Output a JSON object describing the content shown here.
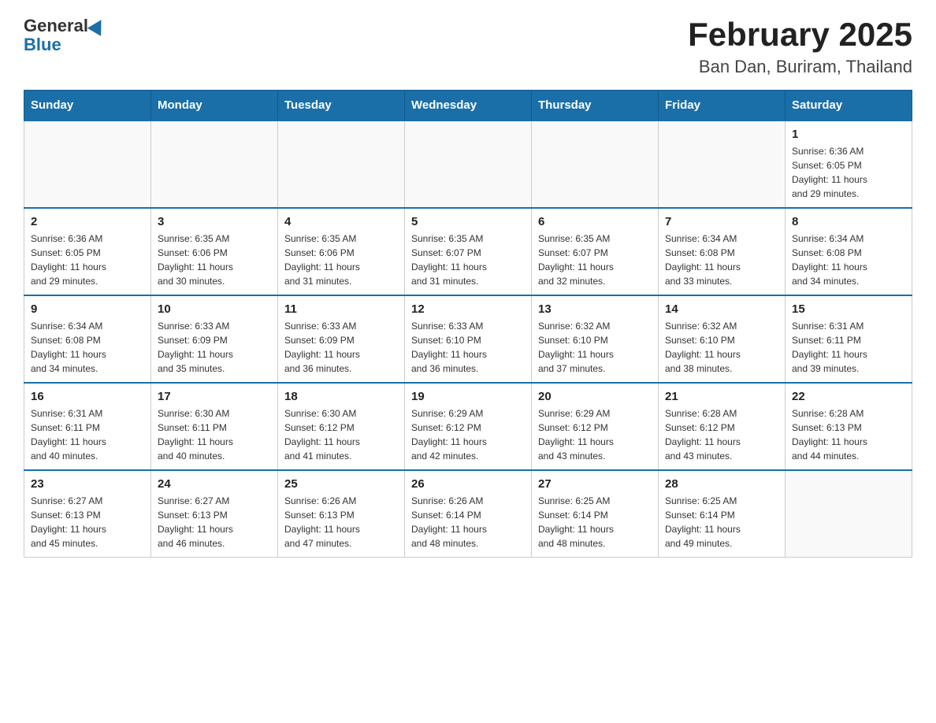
{
  "header": {
    "logo_general": "General",
    "logo_blue": "Blue",
    "title": "February 2025",
    "subtitle": "Ban Dan, Buriram, Thailand"
  },
  "days_of_week": [
    "Sunday",
    "Monday",
    "Tuesday",
    "Wednesday",
    "Thursday",
    "Friday",
    "Saturday"
  ],
  "weeks": [
    {
      "days": [
        {
          "number": "",
          "info": ""
        },
        {
          "number": "",
          "info": ""
        },
        {
          "number": "",
          "info": ""
        },
        {
          "number": "",
          "info": ""
        },
        {
          "number": "",
          "info": ""
        },
        {
          "number": "",
          "info": ""
        },
        {
          "number": "1",
          "info": "Sunrise: 6:36 AM\nSunset: 6:05 PM\nDaylight: 11 hours\nand 29 minutes."
        }
      ]
    },
    {
      "days": [
        {
          "number": "2",
          "info": "Sunrise: 6:36 AM\nSunset: 6:05 PM\nDaylight: 11 hours\nand 29 minutes."
        },
        {
          "number": "3",
          "info": "Sunrise: 6:35 AM\nSunset: 6:06 PM\nDaylight: 11 hours\nand 30 minutes."
        },
        {
          "number": "4",
          "info": "Sunrise: 6:35 AM\nSunset: 6:06 PM\nDaylight: 11 hours\nand 31 minutes."
        },
        {
          "number": "5",
          "info": "Sunrise: 6:35 AM\nSunset: 6:07 PM\nDaylight: 11 hours\nand 31 minutes."
        },
        {
          "number": "6",
          "info": "Sunrise: 6:35 AM\nSunset: 6:07 PM\nDaylight: 11 hours\nand 32 minutes."
        },
        {
          "number": "7",
          "info": "Sunrise: 6:34 AM\nSunset: 6:08 PM\nDaylight: 11 hours\nand 33 minutes."
        },
        {
          "number": "8",
          "info": "Sunrise: 6:34 AM\nSunset: 6:08 PM\nDaylight: 11 hours\nand 34 minutes."
        }
      ]
    },
    {
      "days": [
        {
          "number": "9",
          "info": "Sunrise: 6:34 AM\nSunset: 6:08 PM\nDaylight: 11 hours\nand 34 minutes."
        },
        {
          "number": "10",
          "info": "Sunrise: 6:33 AM\nSunset: 6:09 PM\nDaylight: 11 hours\nand 35 minutes."
        },
        {
          "number": "11",
          "info": "Sunrise: 6:33 AM\nSunset: 6:09 PM\nDaylight: 11 hours\nand 36 minutes."
        },
        {
          "number": "12",
          "info": "Sunrise: 6:33 AM\nSunset: 6:10 PM\nDaylight: 11 hours\nand 36 minutes."
        },
        {
          "number": "13",
          "info": "Sunrise: 6:32 AM\nSunset: 6:10 PM\nDaylight: 11 hours\nand 37 minutes."
        },
        {
          "number": "14",
          "info": "Sunrise: 6:32 AM\nSunset: 6:10 PM\nDaylight: 11 hours\nand 38 minutes."
        },
        {
          "number": "15",
          "info": "Sunrise: 6:31 AM\nSunset: 6:11 PM\nDaylight: 11 hours\nand 39 minutes."
        }
      ]
    },
    {
      "days": [
        {
          "number": "16",
          "info": "Sunrise: 6:31 AM\nSunset: 6:11 PM\nDaylight: 11 hours\nand 40 minutes."
        },
        {
          "number": "17",
          "info": "Sunrise: 6:30 AM\nSunset: 6:11 PM\nDaylight: 11 hours\nand 40 minutes."
        },
        {
          "number": "18",
          "info": "Sunrise: 6:30 AM\nSunset: 6:12 PM\nDaylight: 11 hours\nand 41 minutes."
        },
        {
          "number": "19",
          "info": "Sunrise: 6:29 AM\nSunset: 6:12 PM\nDaylight: 11 hours\nand 42 minutes."
        },
        {
          "number": "20",
          "info": "Sunrise: 6:29 AM\nSunset: 6:12 PM\nDaylight: 11 hours\nand 43 minutes."
        },
        {
          "number": "21",
          "info": "Sunrise: 6:28 AM\nSunset: 6:12 PM\nDaylight: 11 hours\nand 43 minutes."
        },
        {
          "number": "22",
          "info": "Sunrise: 6:28 AM\nSunset: 6:13 PM\nDaylight: 11 hours\nand 44 minutes."
        }
      ]
    },
    {
      "days": [
        {
          "number": "23",
          "info": "Sunrise: 6:27 AM\nSunset: 6:13 PM\nDaylight: 11 hours\nand 45 minutes."
        },
        {
          "number": "24",
          "info": "Sunrise: 6:27 AM\nSunset: 6:13 PM\nDaylight: 11 hours\nand 46 minutes."
        },
        {
          "number": "25",
          "info": "Sunrise: 6:26 AM\nSunset: 6:13 PM\nDaylight: 11 hours\nand 47 minutes."
        },
        {
          "number": "26",
          "info": "Sunrise: 6:26 AM\nSunset: 6:14 PM\nDaylight: 11 hours\nand 48 minutes."
        },
        {
          "number": "27",
          "info": "Sunrise: 6:25 AM\nSunset: 6:14 PM\nDaylight: 11 hours\nand 48 minutes."
        },
        {
          "number": "28",
          "info": "Sunrise: 6:25 AM\nSunset: 6:14 PM\nDaylight: 11 hours\nand 49 minutes."
        },
        {
          "number": "",
          "info": ""
        }
      ]
    }
  ]
}
